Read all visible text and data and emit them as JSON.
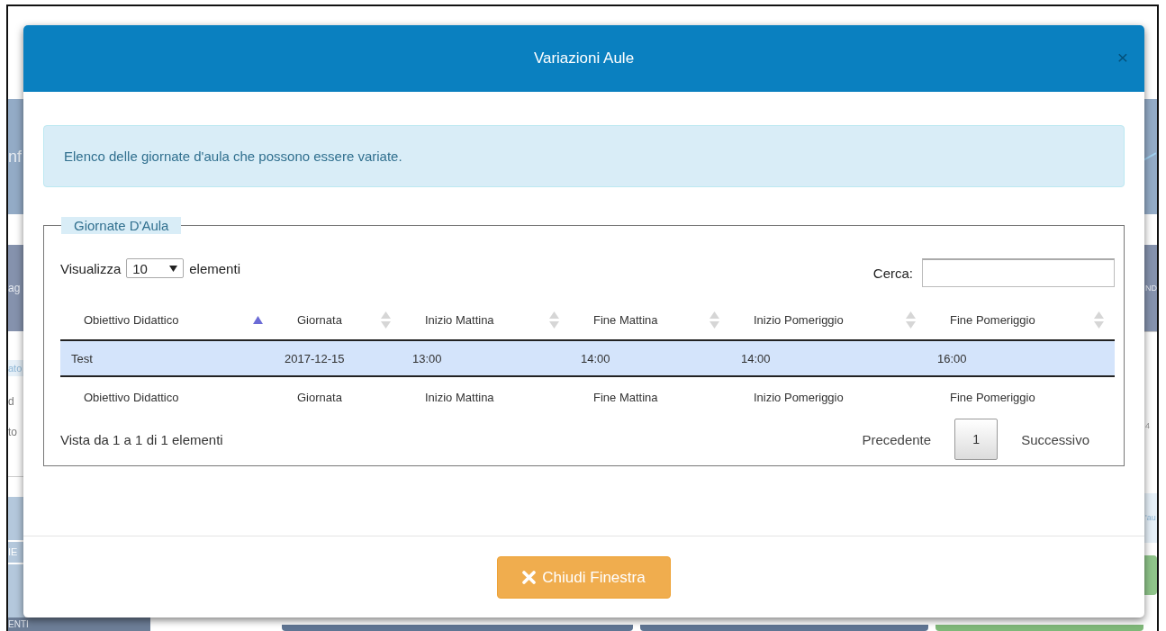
{
  "background": {
    "left": [
      {
        "kind": "header",
        "texts": [
          "nf"
        ]
      },
      {
        "kind": "nav",
        "texts": [
          "ag"
        ]
      },
      {
        "kind": "list",
        "texts": [
          "ato",
          "d",
          "to"
        ]
      },
      {
        "kind": "tiles",
        "texts": [
          "IE"
        ]
      },
      {
        "kind": "footer",
        "texts": [
          "ENTI"
        ]
      }
    ],
    "right": [
      {
        "kind": "header"
      },
      {
        "kind": "nav",
        "texts": [
          "ND"
        ]
      },
      {
        "kind": "list",
        "texts": [
          "4"
        ]
      },
      {
        "kind": "note",
        "texts": [
          "'au"
        ]
      },
      {
        "kind": "action"
      }
    ]
  },
  "modal": {
    "title": "Variazioni Aule",
    "close": "×",
    "alert": "Elenco delle giornate d'aula che possono essere variate.",
    "fieldset": {
      "legend": "Giornate D'Aula",
      "length": {
        "before": "Visualizza",
        "value": "10",
        "after": "elementi"
      },
      "search": {
        "label": "Cerca:"
      },
      "columns": [
        {
          "label": "Obiettivo Didattico",
          "sorted": true
        },
        {
          "label": "Giornata",
          "sorted": false
        },
        {
          "label": "Inizio Mattina",
          "sorted": false
        },
        {
          "label": "Fine Mattina",
          "sorted": false
        },
        {
          "label": "Inizio Pomeriggio",
          "sorted": false
        },
        {
          "label": "Fine Pomeriggio",
          "sorted": false
        }
      ],
      "rows": [
        {
          "selected": true,
          "cells": [
            "Test",
            "2017-12-15",
            "13:00",
            "14:00",
            "14:00",
            "16:00"
          ]
        }
      ],
      "footer_columns": [
        "Obiettivo Didattico",
        "Giornata",
        "Inizio Mattina",
        "Fine Mattina",
        "Inizio Pomeriggio",
        "Fine Pomeriggio"
      ],
      "info": "Vista da 1 a 1 di 1 elementi",
      "pagination": {
        "previous": "Precedente",
        "pages": [
          {
            "label": "1",
            "selected": true
          }
        ],
        "next": "Successivo"
      }
    },
    "close_button": "Chiudi Finestra"
  }
}
